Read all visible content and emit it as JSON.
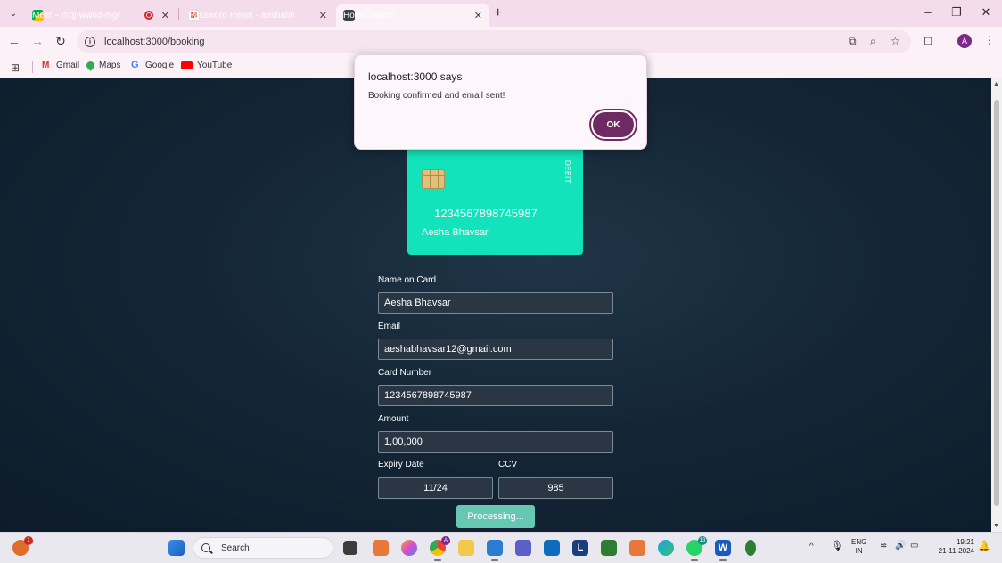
{
  "browser": {
    "tabs": [
      {
        "title": "Meet – mqj-wwnd-mgr",
        "active": false,
        "recording": true
      },
      {
        "title": "Password Reset - aeshabhavsar",
        "active": false
      },
      {
        "title": "Home Vision",
        "active": true
      }
    ],
    "url": "localhost:3000/booking",
    "profile_initial": "A",
    "bookmarks": [
      "Gmail",
      "Maps",
      "Google",
      "YouTube"
    ]
  },
  "dialog": {
    "title": "localhost:3000 says",
    "message": "Booking confirmed and email sent!",
    "ok_label": "OK"
  },
  "card": {
    "type_label": "DEBIT",
    "number": "1234567898745987",
    "holder": "Aesha Bhavsar",
    "color": "#13e3bb"
  },
  "form": {
    "name_label": "Name on Card",
    "name_value": "Aesha Bhavsar",
    "email_label": "Email",
    "email_value": "aeshabhavsar12@gmail.com",
    "card_number_label": "Card Number",
    "card_number_value": "1234567898745987",
    "amount_label": "Amount",
    "amount_value": "1,00,000",
    "expiry_label": "Expiry Date",
    "expiry_value": "11/24",
    "ccv_label": "CCV",
    "ccv_value": "985",
    "submit_label": "Processing..."
  },
  "taskbar": {
    "search_placeholder": "Search",
    "notification_badge": "1",
    "whatsapp_badge": "13",
    "language_line1": "ENG",
    "language_line2": "IN",
    "time": "19:21",
    "date": "21-11-2024"
  }
}
